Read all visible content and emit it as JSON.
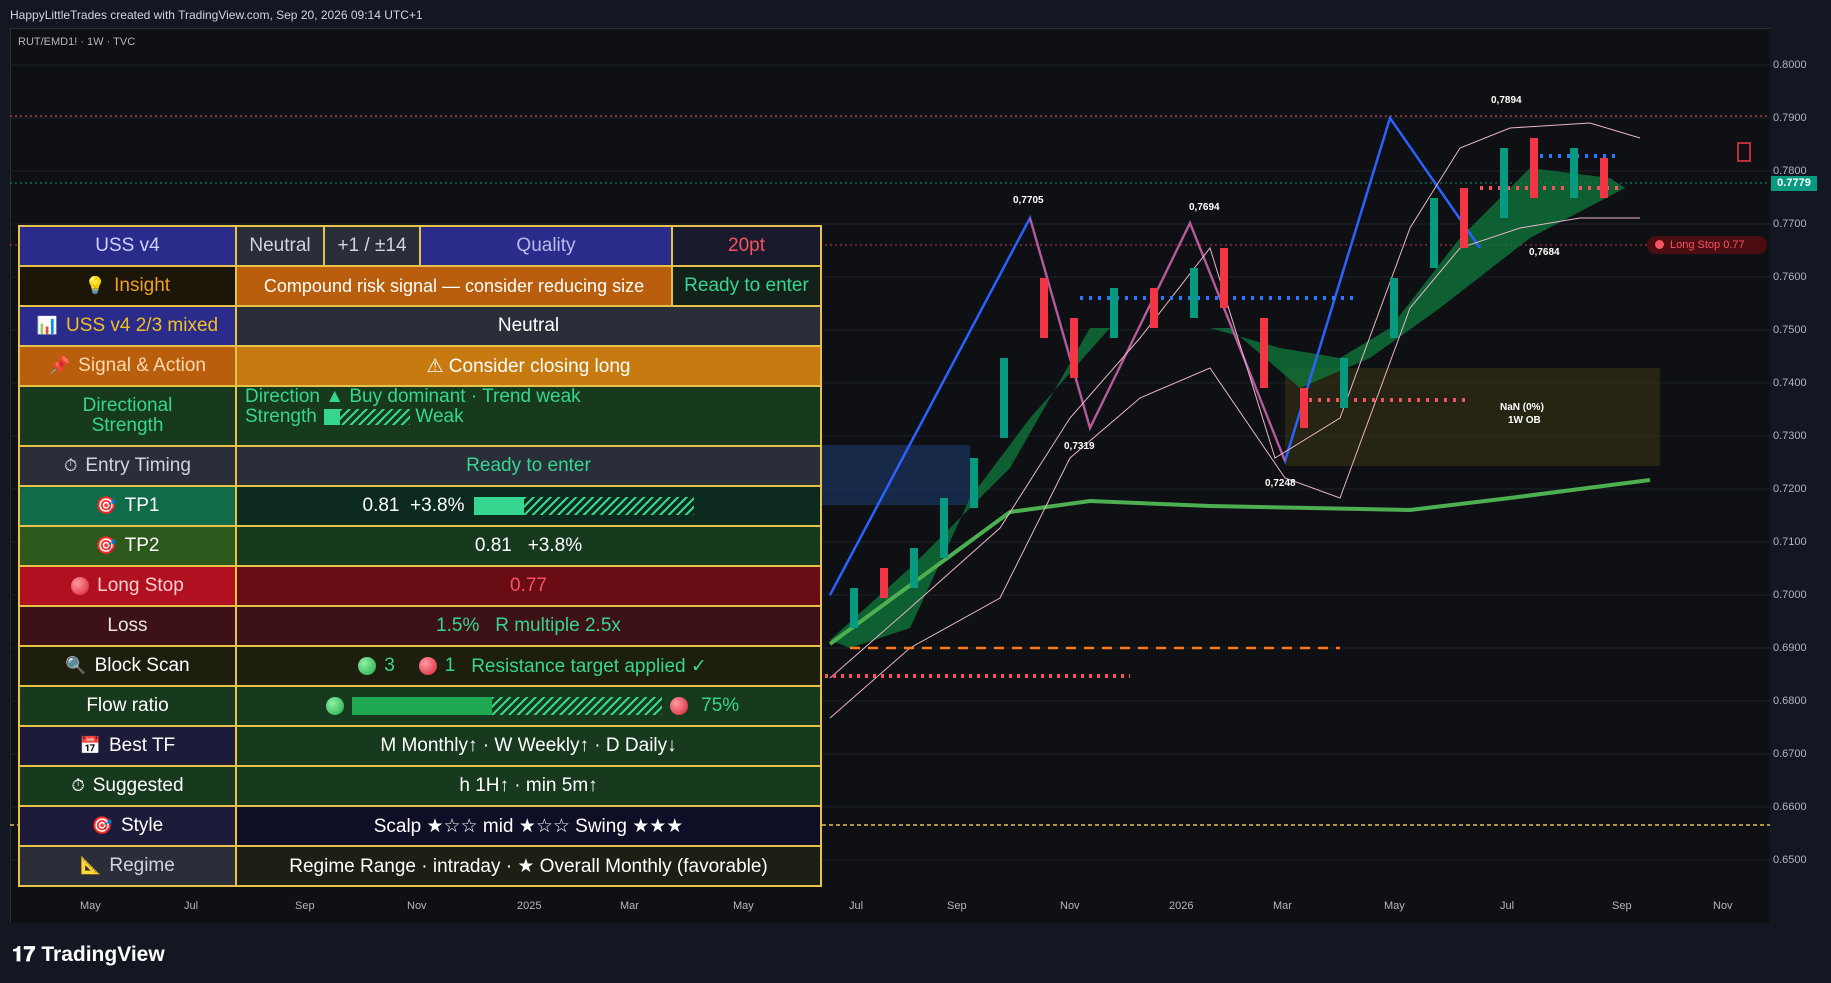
{
  "header": {
    "title": "HappyLittleTrades created with TradingView.com, Sep 20, 2026 09:14 UTC+1",
    "symbol": "RUT/EMD1! · 1W · TVC"
  },
  "price_axis": [
    "0.8000",
    "0.7900",
    "0.7800",
    "0.7700",
    "0.7600",
    "0.7500",
    "0.7400",
    "0.7300",
    "0.7200",
    "0.7100",
    "0.7000",
    "0.6900",
    "0.6800",
    "0.6700",
    "0.6600",
    "0.6500"
  ],
  "time_axis": [
    "May",
    "Jul",
    "Sep",
    "Nov",
    "2025",
    "Mar",
    "May",
    "Jul",
    "Sep",
    "Nov",
    "2026",
    "Mar",
    "May",
    "Jul",
    "Sep",
    "Nov"
  ],
  "current_price": "0.7779",
  "long_stop_badge": "Long Stop  0.77",
  "annotations": {
    "a1": "0,7705",
    "a2": "0,7694",
    "a3": "0,7894",
    "a4": "0,7319",
    "a5": "0,7248",
    "a6": "0,7684",
    "ob": "NaN (0%)",
    "ob2": "1W OB"
  },
  "brand": "TradingView",
  "colors": {
    "accent": "#089981",
    "stop": "#f7525f",
    "border": "#e6c24a"
  },
  "table": {
    "r1": {
      "name": "USS v4",
      "bias": "Neutral",
      "score": "+1 / ±14",
      "quality": "Quality",
      "pts": "20pt"
    },
    "r2": {
      "label": "Insight",
      "icon": "lightbulb-icon",
      "msg": "Compound risk signal — consider reducing size",
      "state": "Ready to enter"
    },
    "r3": {
      "label": "USS v4  2/3 mixed",
      "icon": "chart-icon",
      "value": "Neutral"
    },
    "r4": {
      "label": "Signal & Action",
      "icon": "pin-icon",
      "value": "⚠ Consider closing long"
    },
    "r5": {
      "label1": "Directional",
      "label2": "Strength",
      "dir_label": "Direction",
      "dir_value": "Buy dominant",
      "sep": "·",
      "trend": "Trend weak",
      "str_label": "Strength",
      "str_value": "Weak"
    },
    "r6": {
      "label": "Entry Timing",
      "value": "Ready to enter"
    },
    "r7": {
      "label": "TP1",
      "value": "0.81",
      "pct": "+3.8%"
    },
    "r8": {
      "label": "TP2",
      "value": "0.81",
      "pct": "+3.8%"
    },
    "r9": {
      "label": "Long Stop",
      "value": "0.77"
    },
    "r10": {
      "label": "Loss",
      "value": "1.5%",
      "rm": "R multiple 2.5x"
    },
    "r11": {
      "label": "Block Scan",
      "g": "3",
      "r": "1",
      "msg": "Resistance target applied ✓"
    },
    "r12": {
      "label": "Flow ratio",
      "value": "75%"
    },
    "r13": {
      "label": "Best TF",
      "value": "M Monthly↑ · W Weekly↑ · D Daily↓"
    },
    "r14": {
      "label": "Suggested",
      "value": "h 1H↑ · min 5m↑"
    },
    "r15": {
      "label": "Style",
      "value": "Scalp ★☆☆  mid ★☆☆  Swing ★★★"
    },
    "r16": {
      "label": "Regime",
      "value": "Regime Range · intraday · ★ Overall Monthly (favorable)"
    }
  }
}
